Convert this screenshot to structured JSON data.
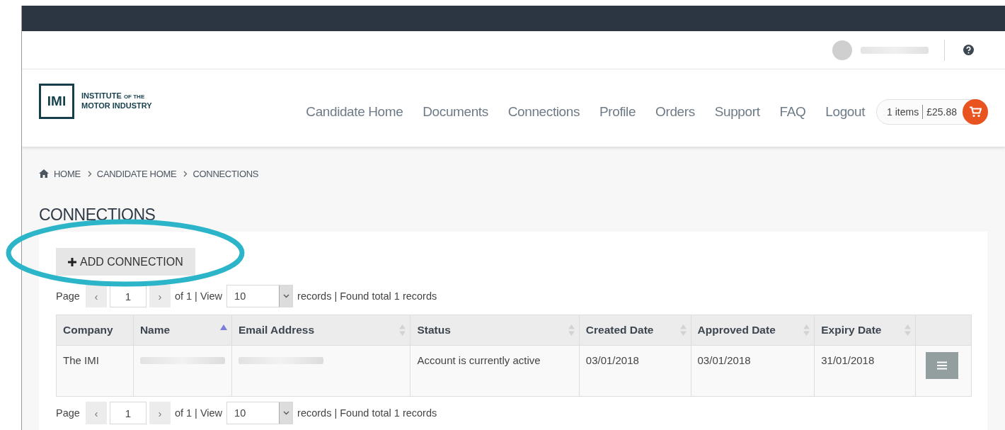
{
  "user_bar": {
    "user_name_redacted": true
  },
  "nav": {
    "logo": {
      "mark": "IMI",
      "line1": "INSTITUTE",
      "small": "OF THE",
      "line2": "MOTOR INDUSTRY"
    },
    "items": [
      {
        "label": "Candidate Home",
        "selected": false
      },
      {
        "label": "Documents",
        "selected": false
      },
      {
        "label": "Connections",
        "selected": false
      },
      {
        "label": "Profile",
        "selected": false
      },
      {
        "label": "Orders",
        "selected": false
      },
      {
        "label": "Support",
        "selected": false
      },
      {
        "label": "FAQ",
        "selected": false
      },
      {
        "label": "Logout",
        "selected": false
      }
    ],
    "cart": {
      "count": "1 items",
      "total": "£25.88"
    }
  },
  "breadcrumb": [
    "HOME",
    "CANDIDATE HOME",
    "CONNECTIONS"
  ],
  "page_title": "CONNECTIONS",
  "add_button": "ADD CONNECTION",
  "pagers": [
    {
      "label": "Page",
      "prev": "‹",
      "page": "1",
      "next": "›",
      "of": "of 1 | View",
      "per_page": "10",
      "summary": "records | Found total 1 records"
    },
    {
      "label": "Page",
      "prev": "‹",
      "page": "1",
      "next": "›",
      "of": "of 1 | View",
      "per_page": "10",
      "summary": "records | Found total 1 records"
    }
  ],
  "table": {
    "columns": [
      {
        "label": "Company"
      },
      {
        "label": "Name",
        "sorted": true
      },
      {
        "label": "Email Address",
        "sorted": false
      },
      {
        "label": "Status",
        "sorted": false
      },
      {
        "label": "Created Date",
        "sorted": false
      },
      {
        "label": "Approved Date",
        "sorted": false
      },
      {
        "label": "Expiry Date",
        "sorted": false
      },
      {}
    ],
    "rows": [
      {
        "cells": [
          {
            "text": "The IMI"
          },
          {
            "redacted": true
          },
          {
            "redacted": true
          },
          {
            "text": "Account is currently active"
          },
          {
            "text": "03/01/2018"
          },
          {
            "text": "03/01/2018"
          },
          {
            "text": "31/01/2018"
          },
          {
            "kind": "menu"
          }
        ]
      }
    ]
  },
  "annotation": {
    "kind": "ellipse",
    "color": "#2cb5c9"
  }
}
